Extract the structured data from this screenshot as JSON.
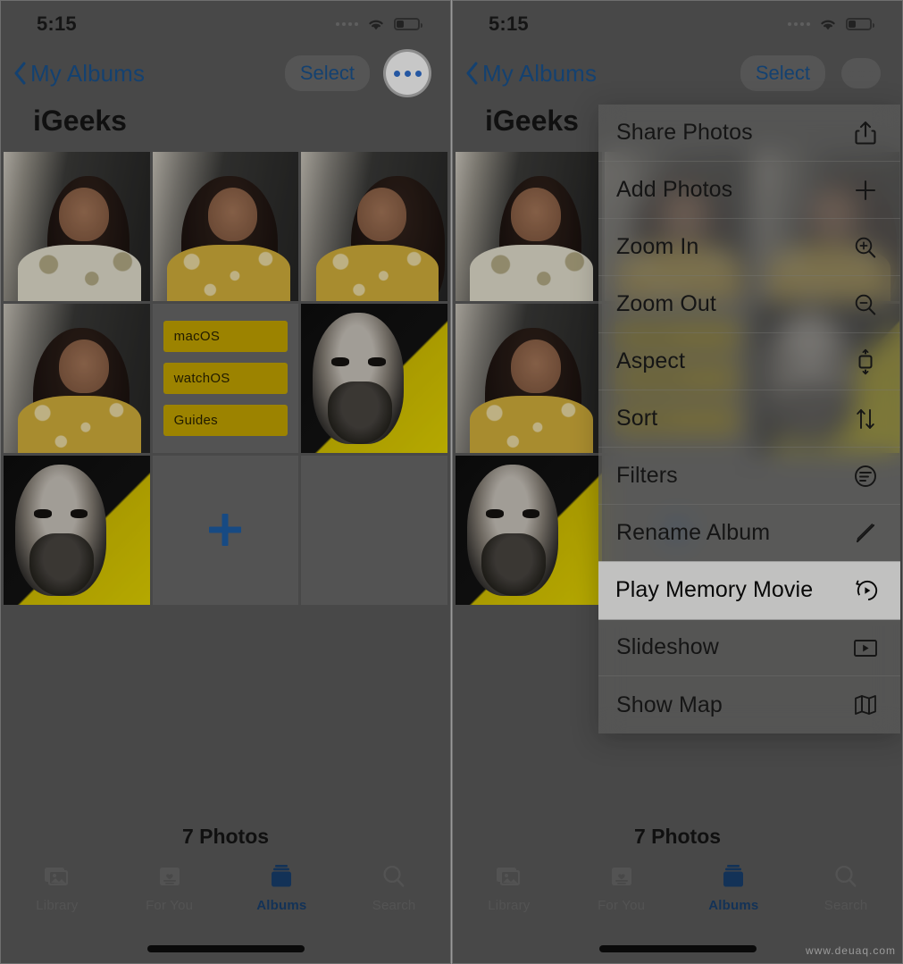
{
  "status_bar": {
    "time": "5:15",
    "cellular_icon": "cellular-dots-icon",
    "wifi_icon": "wifi-icon",
    "battery_icon": "battery-icon",
    "battery_level_percent": 33
  },
  "nav": {
    "back_icon": "chevron-left-icon",
    "back_label": "My Albums",
    "select_label": "Select",
    "more_icon": "ellipsis-icon"
  },
  "album": {
    "title": "iGeeks",
    "photo_count_label": "7 Photos",
    "add_icon": "plus-icon"
  },
  "os_tile": {
    "chips": [
      "macOS",
      "watchOS",
      "Guides"
    ]
  },
  "tabs": [
    {
      "label": "Library",
      "icon": "photo-stack-icon",
      "active": false
    },
    {
      "label": "For You",
      "icon": "for-you-card-icon",
      "active": false
    },
    {
      "label": "Albums",
      "icon": "albums-stack-icon",
      "active": true
    },
    {
      "label": "Search",
      "icon": "magnifier-icon",
      "active": false
    }
  ],
  "context_menu": {
    "items": [
      {
        "label": "Share Photos",
        "icon": "share-icon",
        "highlighted": false
      },
      {
        "label": "Add Photos",
        "icon": "plus-icon",
        "highlighted": false
      },
      {
        "label": "Zoom In",
        "icon": "zoom-in-icon",
        "highlighted": false
      },
      {
        "label": "Zoom Out",
        "icon": "zoom-out-icon",
        "highlighted": false
      },
      {
        "label": "Aspect",
        "icon": "aspect-icon",
        "highlighted": false
      },
      {
        "label": "Sort",
        "icon": "sort-arrows-icon",
        "highlighted": false
      },
      {
        "label": "Filters",
        "icon": "filters-icon",
        "highlighted": false
      },
      {
        "label": "Rename Album",
        "icon": "pencil-icon",
        "highlighted": false
      },
      {
        "label": "Play Memory Movie",
        "icon": "memory-movie-icon",
        "highlighted": true
      },
      {
        "label": "Slideshow",
        "icon": "slideshow-icon",
        "highlighted": false
      },
      {
        "label": "Show Map",
        "icon": "map-icon",
        "highlighted": false
      }
    ]
  },
  "colors": {
    "accent_blue": "#19538f",
    "tab_active_blue": "#18406f",
    "highlight_bg": "#f8f8f6",
    "menu_bg": "rgba(120,120,118,.62)"
  },
  "watermark": "www.deuaq.com"
}
